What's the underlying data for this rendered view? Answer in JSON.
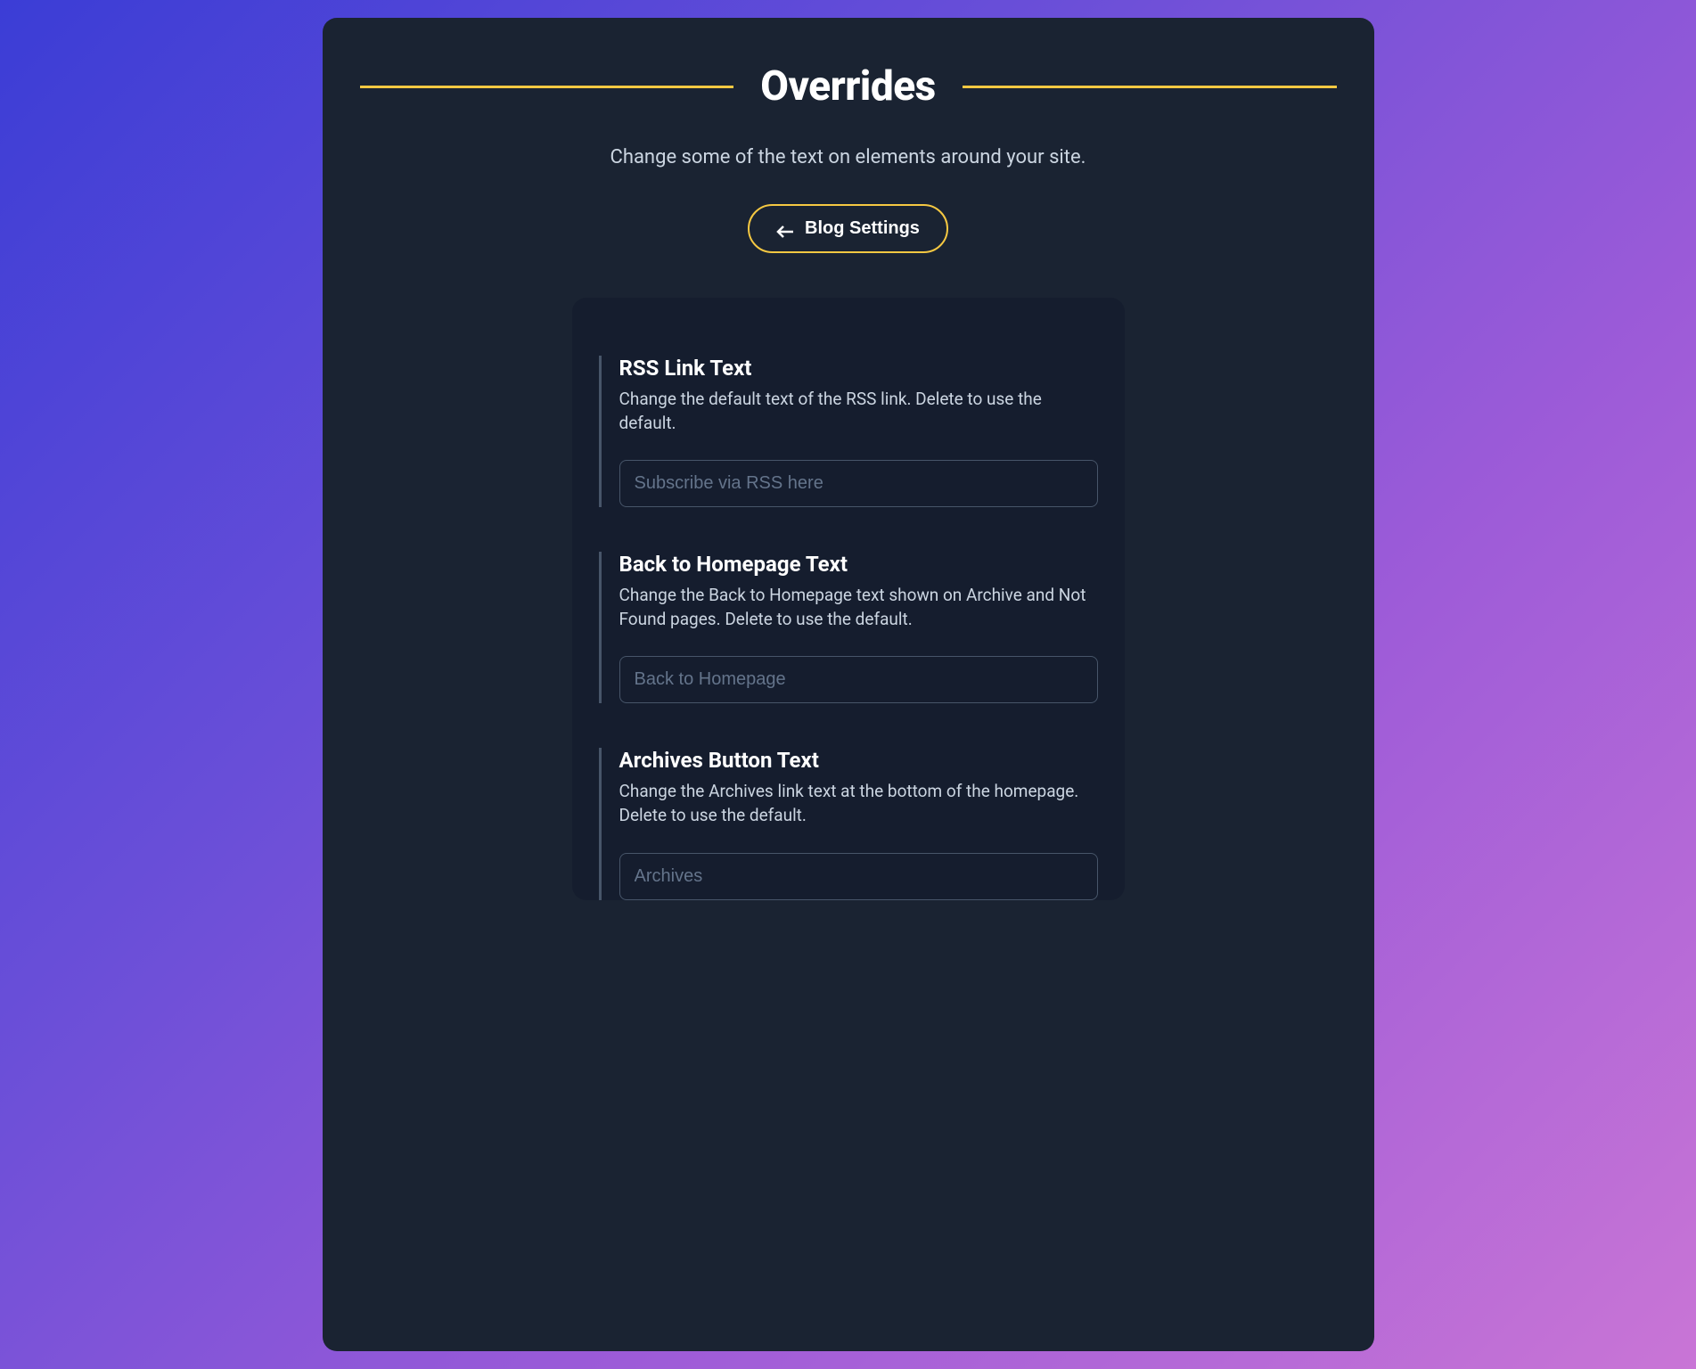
{
  "header": {
    "title": "Overrides",
    "subtitle": "Change some of the text on elements around your site.",
    "back_button_label": "Blog Settings"
  },
  "settings": {
    "rss": {
      "title": "RSS Link Text",
      "description": "Change the default text of the RSS link. Delete to use the default.",
      "placeholder": "Subscribe via RSS here"
    },
    "homepage": {
      "title": "Back to Homepage Text",
      "description": "Change the Back to Homepage text shown on Archive and Not Found pages. Delete to use the default.",
      "placeholder": "Back to Homepage"
    },
    "archives": {
      "title": "Archives Button Text",
      "description": "Change the Archives link text at the bottom of the homepage. Delete to use the default.",
      "placeholder": "Archives"
    }
  }
}
